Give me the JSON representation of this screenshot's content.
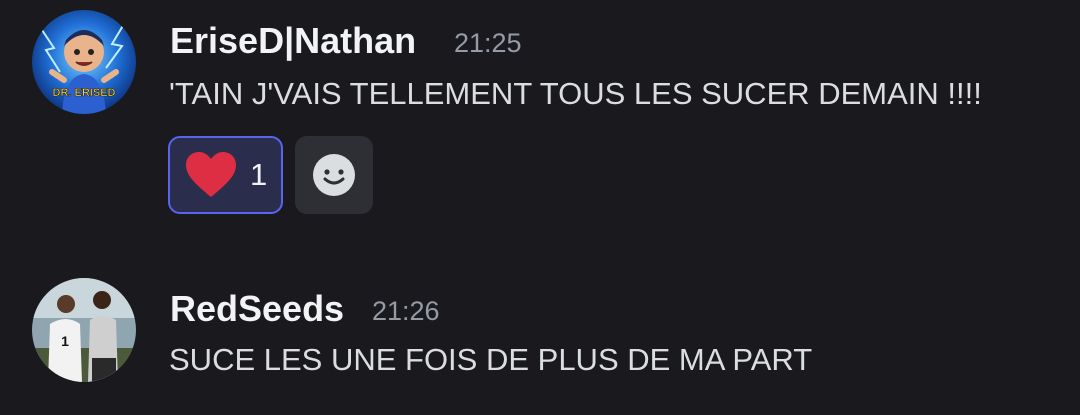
{
  "messages": [
    {
      "username": "EriseD|Nathan",
      "timestamp": "21:25",
      "content": "'TAIN J'VAIS TELLEMENT TOUS LES SUCER DEMAIN !!!!",
      "avatar_text": "DR. ERISED",
      "reactions": [
        {
          "emoji": "red-heart-icon",
          "count": "1",
          "reacted_by_me": true
        }
      ]
    },
    {
      "username": "RedSeeds",
      "timestamp": "21:26",
      "content": "SUCE LES UNE FOIS DE PLUS DE MA PART",
      "reactions": []
    }
  ],
  "colors": {
    "background": "#1a1a1e",
    "username": "#f2f3f5",
    "timestamp": "#949ba4",
    "message_text": "#dbdee1",
    "reaction_border": "#5865f2",
    "reaction_bg": "#2b2d4d",
    "heart": "#dd2e44"
  }
}
